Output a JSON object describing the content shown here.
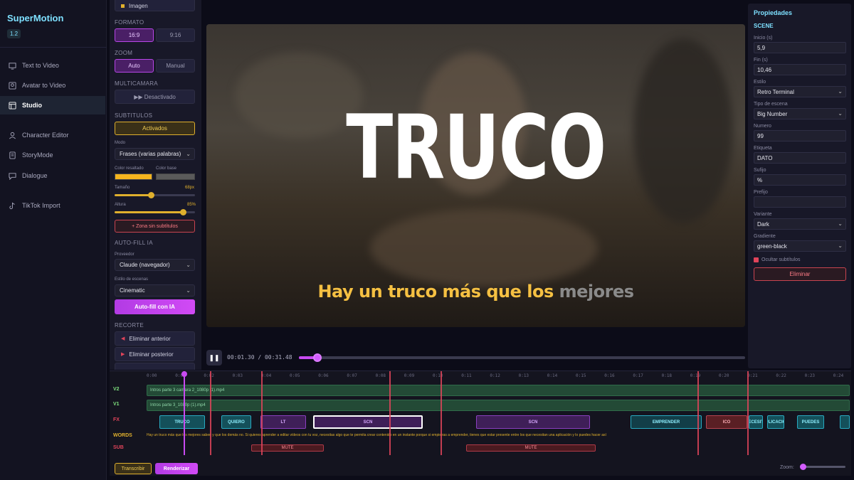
{
  "app": {
    "name": "SuperMotion",
    "version": "1.2"
  },
  "nav": {
    "items": [
      {
        "label": "Text to Video",
        "icon": "monitor-icon"
      },
      {
        "label": "Avatar to Video",
        "icon": "avatar-icon"
      },
      {
        "label": "Studio",
        "icon": "layout-icon",
        "active": true
      },
      {
        "label": "Character Editor",
        "icon": "person-icon"
      },
      {
        "label": "StoryMode",
        "icon": "document-icon"
      },
      {
        "label": "Dialogue",
        "icon": "chat-icon"
      },
      {
        "label": "TikTok Import",
        "icon": "tiktok-icon"
      }
    ]
  },
  "settings": {
    "top_item": "Imagen",
    "formato": {
      "title": "FORMATO",
      "options": [
        "16:9",
        "9:16"
      ],
      "selected": "16:9"
    },
    "zoom": {
      "title": "ZOOM",
      "options": [
        "Auto",
        "Manual"
      ],
      "selected": "Auto"
    },
    "multicamara": {
      "title": "MULTICAMARA",
      "button": "▶▶ Desactivado"
    },
    "subtitulos": {
      "title": "SUBTITULOS",
      "button": "Activados",
      "modo_label": "Modo",
      "modo": "Frases (varias palabras)",
      "color_resaltado_label": "Color resaltado",
      "color_base_label": "Color base",
      "color_resaltado": "#f5b41e",
      "color_base": "#5a5a5a",
      "tamano_label": "Tamaño",
      "tamano_value": "68px",
      "tamano_fraction": 0.45,
      "altura_label": "Altura",
      "altura_value": "85%",
      "altura_fraction": 0.85,
      "zona_button": "+ Zona sin subtítulos"
    },
    "autofill": {
      "title": "AUTO-FILL IA",
      "proveedor_label": "Proveedor",
      "proveedor": "Claude (navegador)",
      "estilo_label": "Estilo de escenas",
      "estilo": "Cinematic",
      "button": "Auto-fill con IA"
    },
    "recorte": {
      "title": "RECORTE",
      "eliminar_anterior": "Eliminar anterior",
      "eliminar_posterior": "Eliminar posterior"
    }
  },
  "preview": {
    "big_word": "TRUCO",
    "subtitle_highlight": "Hay un truco más que los",
    "subtitle_rest": "mejores"
  },
  "player": {
    "time": "00:01.30 / 00:31.48",
    "progress": 0.041
  },
  "properties": {
    "title": "Propiedades",
    "section": "SCENE",
    "fields": [
      {
        "label": "Inicio (s)",
        "value": "5,9",
        "type": "input"
      },
      {
        "label": "Fin (s)",
        "value": "10,46",
        "type": "input"
      },
      {
        "label": "Estilo",
        "value": "Retro Terminal",
        "type": "select"
      },
      {
        "label": "Tipo de escena",
        "value": "Big Number",
        "type": "select"
      },
      {
        "label": "Numero",
        "value": "99",
        "type": "input"
      },
      {
        "label": "Etiqueta",
        "value": "DATO",
        "type": "input"
      },
      {
        "label": "Sufijo",
        "value": "%",
        "type": "input"
      },
      {
        "label": "Prefijo",
        "value": "",
        "type": "input"
      },
      {
        "label": "Variante",
        "value": "Dark",
        "type": "select"
      },
      {
        "label": "Gradiente",
        "value": "green-black",
        "type": "select"
      }
    ],
    "checkbox_label": "Ocultar subtítulos",
    "delete_button": "Eliminar"
  },
  "timeline": {
    "ticks": [
      "0:00",
      "0:01",
      "0:02",
      "0:03",
      "0:04",
      "0:05",
      "0:06",
      "0:07",
      "0:08",
      "0:09",
      "0:10",
      "0:11",
      "0:12",
      "0:13",
      "0:14",
      "0:15",
      "0:16",
      "0:17",
      "0:18",
      "0:19",
      "0:20",
      "0:21",
      "0:22",
      "0:23",
      "0:24"
    ],
    "tracks": [
      "V2",
      "V1",
      "FX",
      "WORDS",
      "SUB"
    ],
    "v2_clip": "Intros parte 3 camara 2_1080p (1).mp4",
    "v1_clip": "Intros parte 3_1080p (1).mp4",
    "fx_clips": [
      {
        "label": "TRUCO",
        "color": "cyan"
      },
      {
        "label": "QUIERO",
        "color": "cyan"
      },
      {
        "label": "LT",
        "color": "purple"
      },
      {
        "label": "SCN",
        "color": "purple",
        "selected": true
      },
      {
        "label": "SCN",
        "color": "purple"
      },
      {
        "label": "EMPRENDER",
        "color": "cyan"
      },
      {
        "label": "ICO",
        "color": "red"
      },
      {
        "label": "NECESITA",
        "color": "cyan"
      },
      {
        "label": "APLICACION",
        "color": "cyan"
      },
      {
        "label": "PUEDES",
        "color": "cyan"
      }
    ],
    "words_text": "Hay un truco más que los mejores saben y que los demás no. Si quieres aprender a editar vídeos con tu voz, necesitas algo que te permita crear contenido en un instante porque si empiezas a emprender, tienes que estar presente entre los que necesitan una aplicación y lo puedes hacer así",
    "sub_clips": [
      {
        "label": "MUTE"
      },
      {
        "label": "MUTE"
      }
    ],
    "transcribe_button": "Transcribir",
    "render_button": "Renderizar",
    "zoom_label": "Zoom:"
  }
}
